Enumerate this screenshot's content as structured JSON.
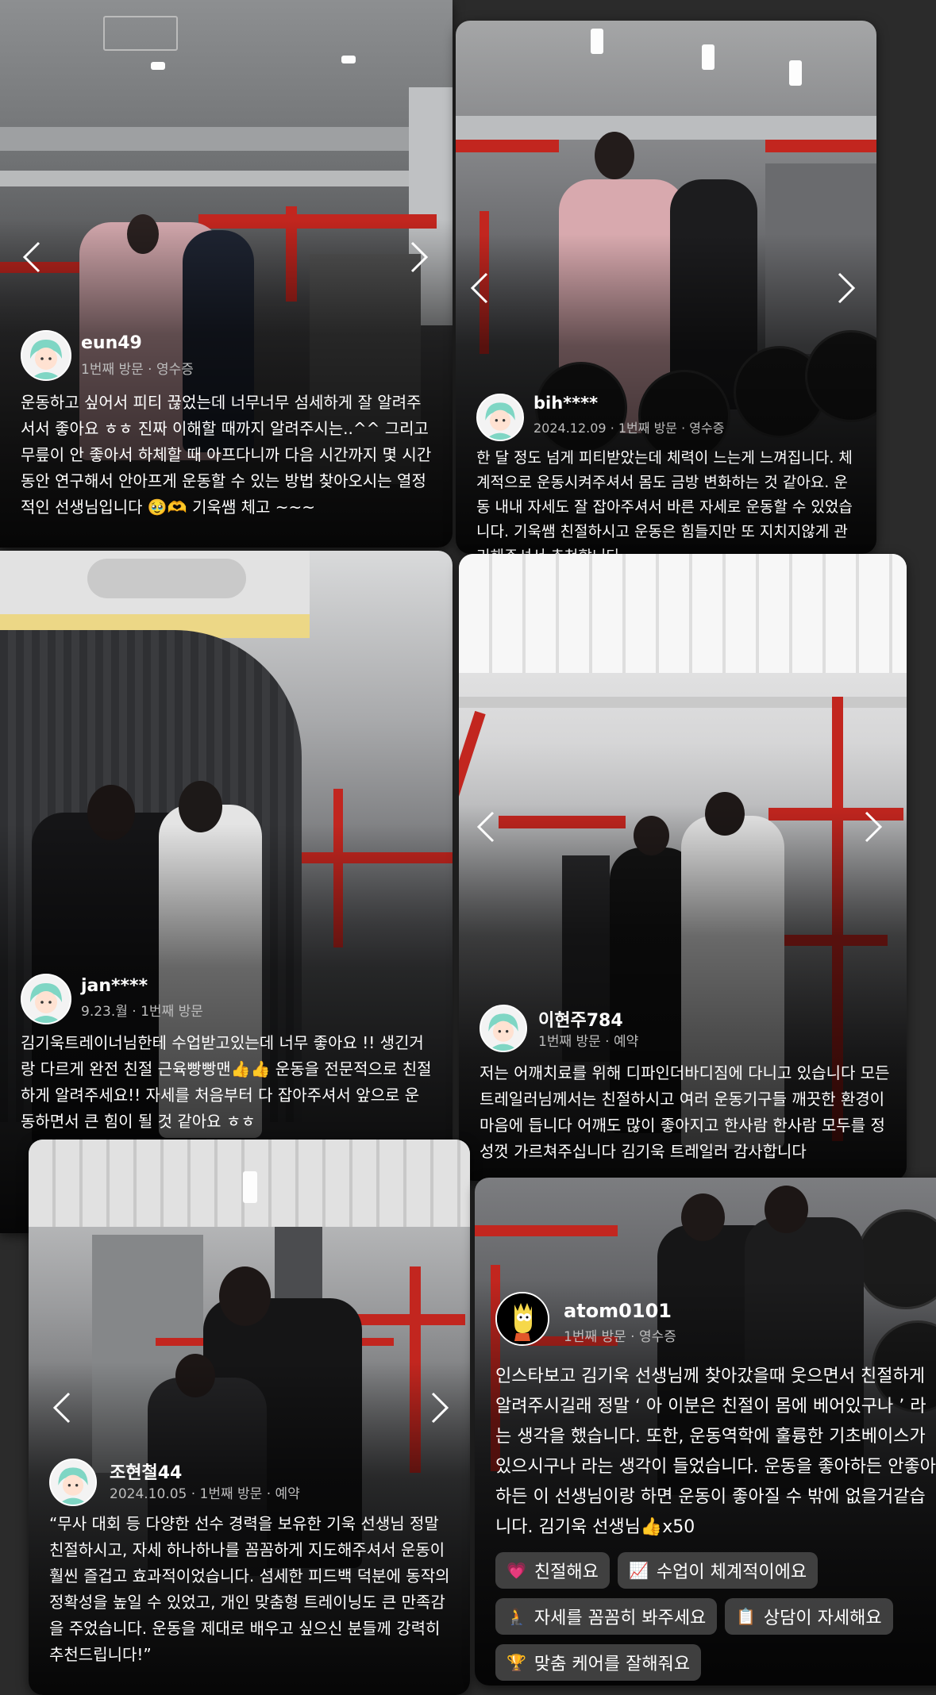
{
  "reviews": [
    {
      "username": "eun49",
      "meta": "1번째 방문 · 영수증",
      "text": "운동하고 싶어서 피티 끊었는데 너무너무 섬세하게 잘 알려주서서 좋아요 ㅎㅎ 진짜 이해할 때까지 알려주시는..^^ 그리고 무릎이 안 좋아서 하체할 때 아프다니까 다음 시간까지 몇 시간 동안 연구해서 안아프게 운동할 수 있는 방법 찾아오시는 열정적인 선생님입니다 🥹🫶 기욱쌤 체고 ~~~"
    },
    {
      "username": "bih****",
      "meta": "2024.12.09 · 1번째 방문 · 영수증",
      "text": "한 달 정도 넘게 피티받았는데 체력이 느는게 느껴집니다. 체계적으로 운동시켜주셔서 몸도 금방 변화하는 것 같아요. 운동 내내 자세도 잘 잡아주셔서 바른 자세로 운동할 수 있었습니다. 기욱쌤 친절하시고 운동은 힘들지만 또 지치지않게 관리해주셔서 추천합니다"
    },
    {
      "username": "jan****",
      "meta": "9.23.월 · 1번째 방문",
      "text": "김기욱트레이너님한테 수업받고있는데 너무 좋아요 !! 생긴거랑 다르게 완전 친절 근육빵빵맨👍👍 운동을 전문적으로 친절하게 알려주세요!! 자세를 처음부터 다 잡아주셔서 앞으로 운동하면서 큰 힘이 될 것 같아요 ㅎㅎ"
    },
    {
      "username": "이현주784",
      "meta": "1번째 방문 · 예약",
      "text": "저는 어깨치료를 위해 디파인더바디짐에 다니고 있습니다 모든 트레일러님께서는 친절하시고 여러 운동기구들 깨끗한 환경이 마음에 듭니다 어깨도 많이 좋아지고 한사람 한사람 모두를 정성껏 가르쳐주십니다 김기욱 트레일러 감사합니다"
    },
    {
      "username": "조현철44",
      "meta": "2024.10.05 · 1번째 방문 · 예약",
      "text": "“무사 대회 등 다양한 선수 경력을 보유한 기욱 선생님 정말 친절하시고, 자세 하나하나를 꼼꼼하게 지도해주셔서 운동이 훨씬 즐겁고 효과적이었습니다. 섬세한 피드백 덕분에 동작의 정확성을 높일 수 있었고, 개인 맞춤형 트레이닝도 큰 만족감을 주었습니다. 운동을 제대로 배우고 싶으신 분들께 강력히 추천드립니다!”"
    },
    {
      "username": "atom0101",
      "meta": "1번째 방문 · 영수증",
      "text": "인스타보고 김기욱 선생님께 찾아갔을때 웃으면서 친절하게 알려주시길래 정말 ‘ 아 이분은 친절이 몸에 베어있구나 ’ 라는 생각을 했습니다. 또한, 운동역학에 훌륭한 기초베이스가 있으시구나 라는 생각이 들었습니다. 운동을 좋아하든 안좋아하든 이 선생님이랑 하면 운동이 좋아질 수 밖에 없을거같습니다. 김기욱 선생님👍x50",
      "keywords": [
        {
          "icon": "💗",
          "label": "친절해요"
        },
        {
          "icon": "📈",
          "label": "수업이 체계적이에요"
        },
        {
          "icon": "🧎",
          "label": "자세를 꼼꼼히 봐주세요"
        },
        {
          "icon": "📋",
          "label": "상담이 자세해요"
        },
        {
          "icon": "🏆",
          "label": "맞춤 케어를 잘해줘요"
        }
      ]
    }
  ],
  "icons": {
    "nav_prev": "chevron-left-icon",
    "nav_next": "chevron-right-icon",
    "avatar_default": "mint-hair-avatar",
    "avatar_atom": "cartoon-character-avatar"
  },
  "colors": {
    "gym_red": "#c2261f",
    "text_meta": "#bdbdbd",
    "chip_bg": "#464646"
  }
}
